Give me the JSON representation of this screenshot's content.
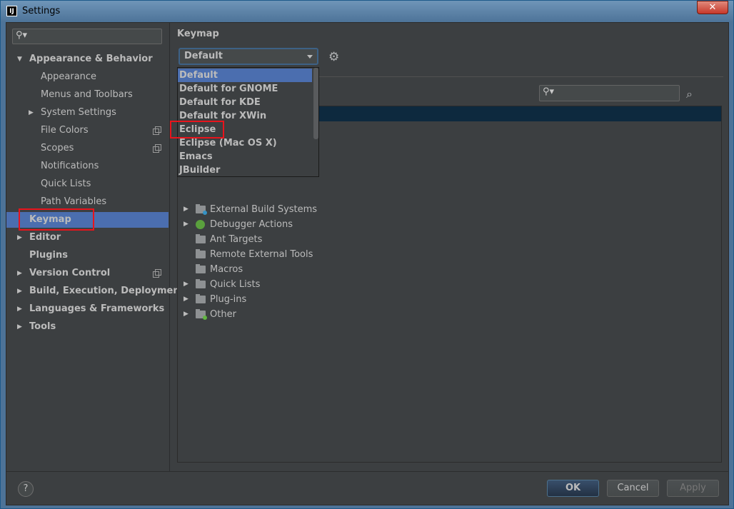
{
  "window": {
    "title": "Settings",
    "app_icon": "IJ",
    "close_label": "✕"
  },
  "sidebar": {
    "search_placeholder": "",
    "items": [
      {
        "label": "Appearance & Behavior",
        "level": 0,
        "expanded": true,
        "bold": true
      },
      {
        "label": "Appearance",
        "level": 1
      },
      {
        "label": "Menus and Toolbars",
        "level": 1
      },
      {
        "label": "System Settings",
        "level": 1,
        "expandable": true
      },
      {
        "label": "File Colors",
        "level": 1,
        "copy_icon": true
      },
      {
        "label": "Scopes",
        "level": 1,
        "copy_icon": true
      },
      {
        "label": "Notifications",
        "level": 1
      },
      {
        "label": "Quick Lists",
        "level": 1
      },
      {
        "label": "Path Variables",
        "level": 1
      },
      {
        "label": "Keymap",
        "level": 0,
        "selected": true,
        "bold": true
      },
      {
        "label": "Editor",
        "level": 0,
        "expandable": true,
        "bold": true
      },
      {
        "label": "Plugins",
        "level": 0,
        "bold": true
      },
      {
        "label": "Version Control",
        "level": 0,
        "expandable": true,
        "bold": true,
        "copy_icon": true
      },
      {
        "label": "Build, Execution, Deployment",
        "level": 0,
        "expandable": true,
        "bold": true
      },
      {
        "label": "Languages & Frameworks",
        "level": 0,
        "expandable": true,
        "bold": true
      },
      {
        "label": "Tools",
        "level": 0,
        "expandable": true,
        "bold": true
      }
    ]
  },
  "main": {
    "title": "Keymap",
    "keymap_combo": {
      "value": "Default"
    },
    "dropdown_options": [
      "Default",
      "Default for GNOME",
      "Default for KDE",
      "Default for XWin",
      "Eclipse",
      "Eclipse (Mac OS X)",
      "Emacs",
      "JBuilder"
    ],
    "dropdown_selected_index": 0,
    "actions_tree": [
      {
        "label": "External Build Systems",
        "expandable": true,
        "icon": "folder-icon",
        "badge_color": "#3592c4"
      },
      {
        "label": "Debugger Actions",
        "expandable": true,
        "icon": "bug-icon"
      },
      {
        "label": "Ant Targets",
        "expandable": false,
        "icon": "folder-icon"
      },
      {
        "label": "Remote External Tools",
        "expandable": false,
        "icon": "folder-icon"
      },
      {
        "label": "Macros",
        "expandable": false,
        "icon": "folder-icon"
      },
      {
        "label": "Quick Lists",
        "expandable": true,
        "icon": "folder-icon"
      },
      {
        "label": "Plug-ins",
        "expandable": true,
        "icon": "folder-icon"
      },
      {
        "label": "Other",
        "expandable": true,
        "icon": "folder-icon",
        "badge_color": "#62b543"
      }
    ]
  },
  "footer": {
    "help_label": "?",
    "ok_label": "OK",
    "cancel_label": "Cancel",
    "apply_label": "Apply"
  },
  "colors": {
    "selection": "#4b6eaf",
    "background": "#3c3f41",
    "highlight_box": "#e8141c"
  }
}
